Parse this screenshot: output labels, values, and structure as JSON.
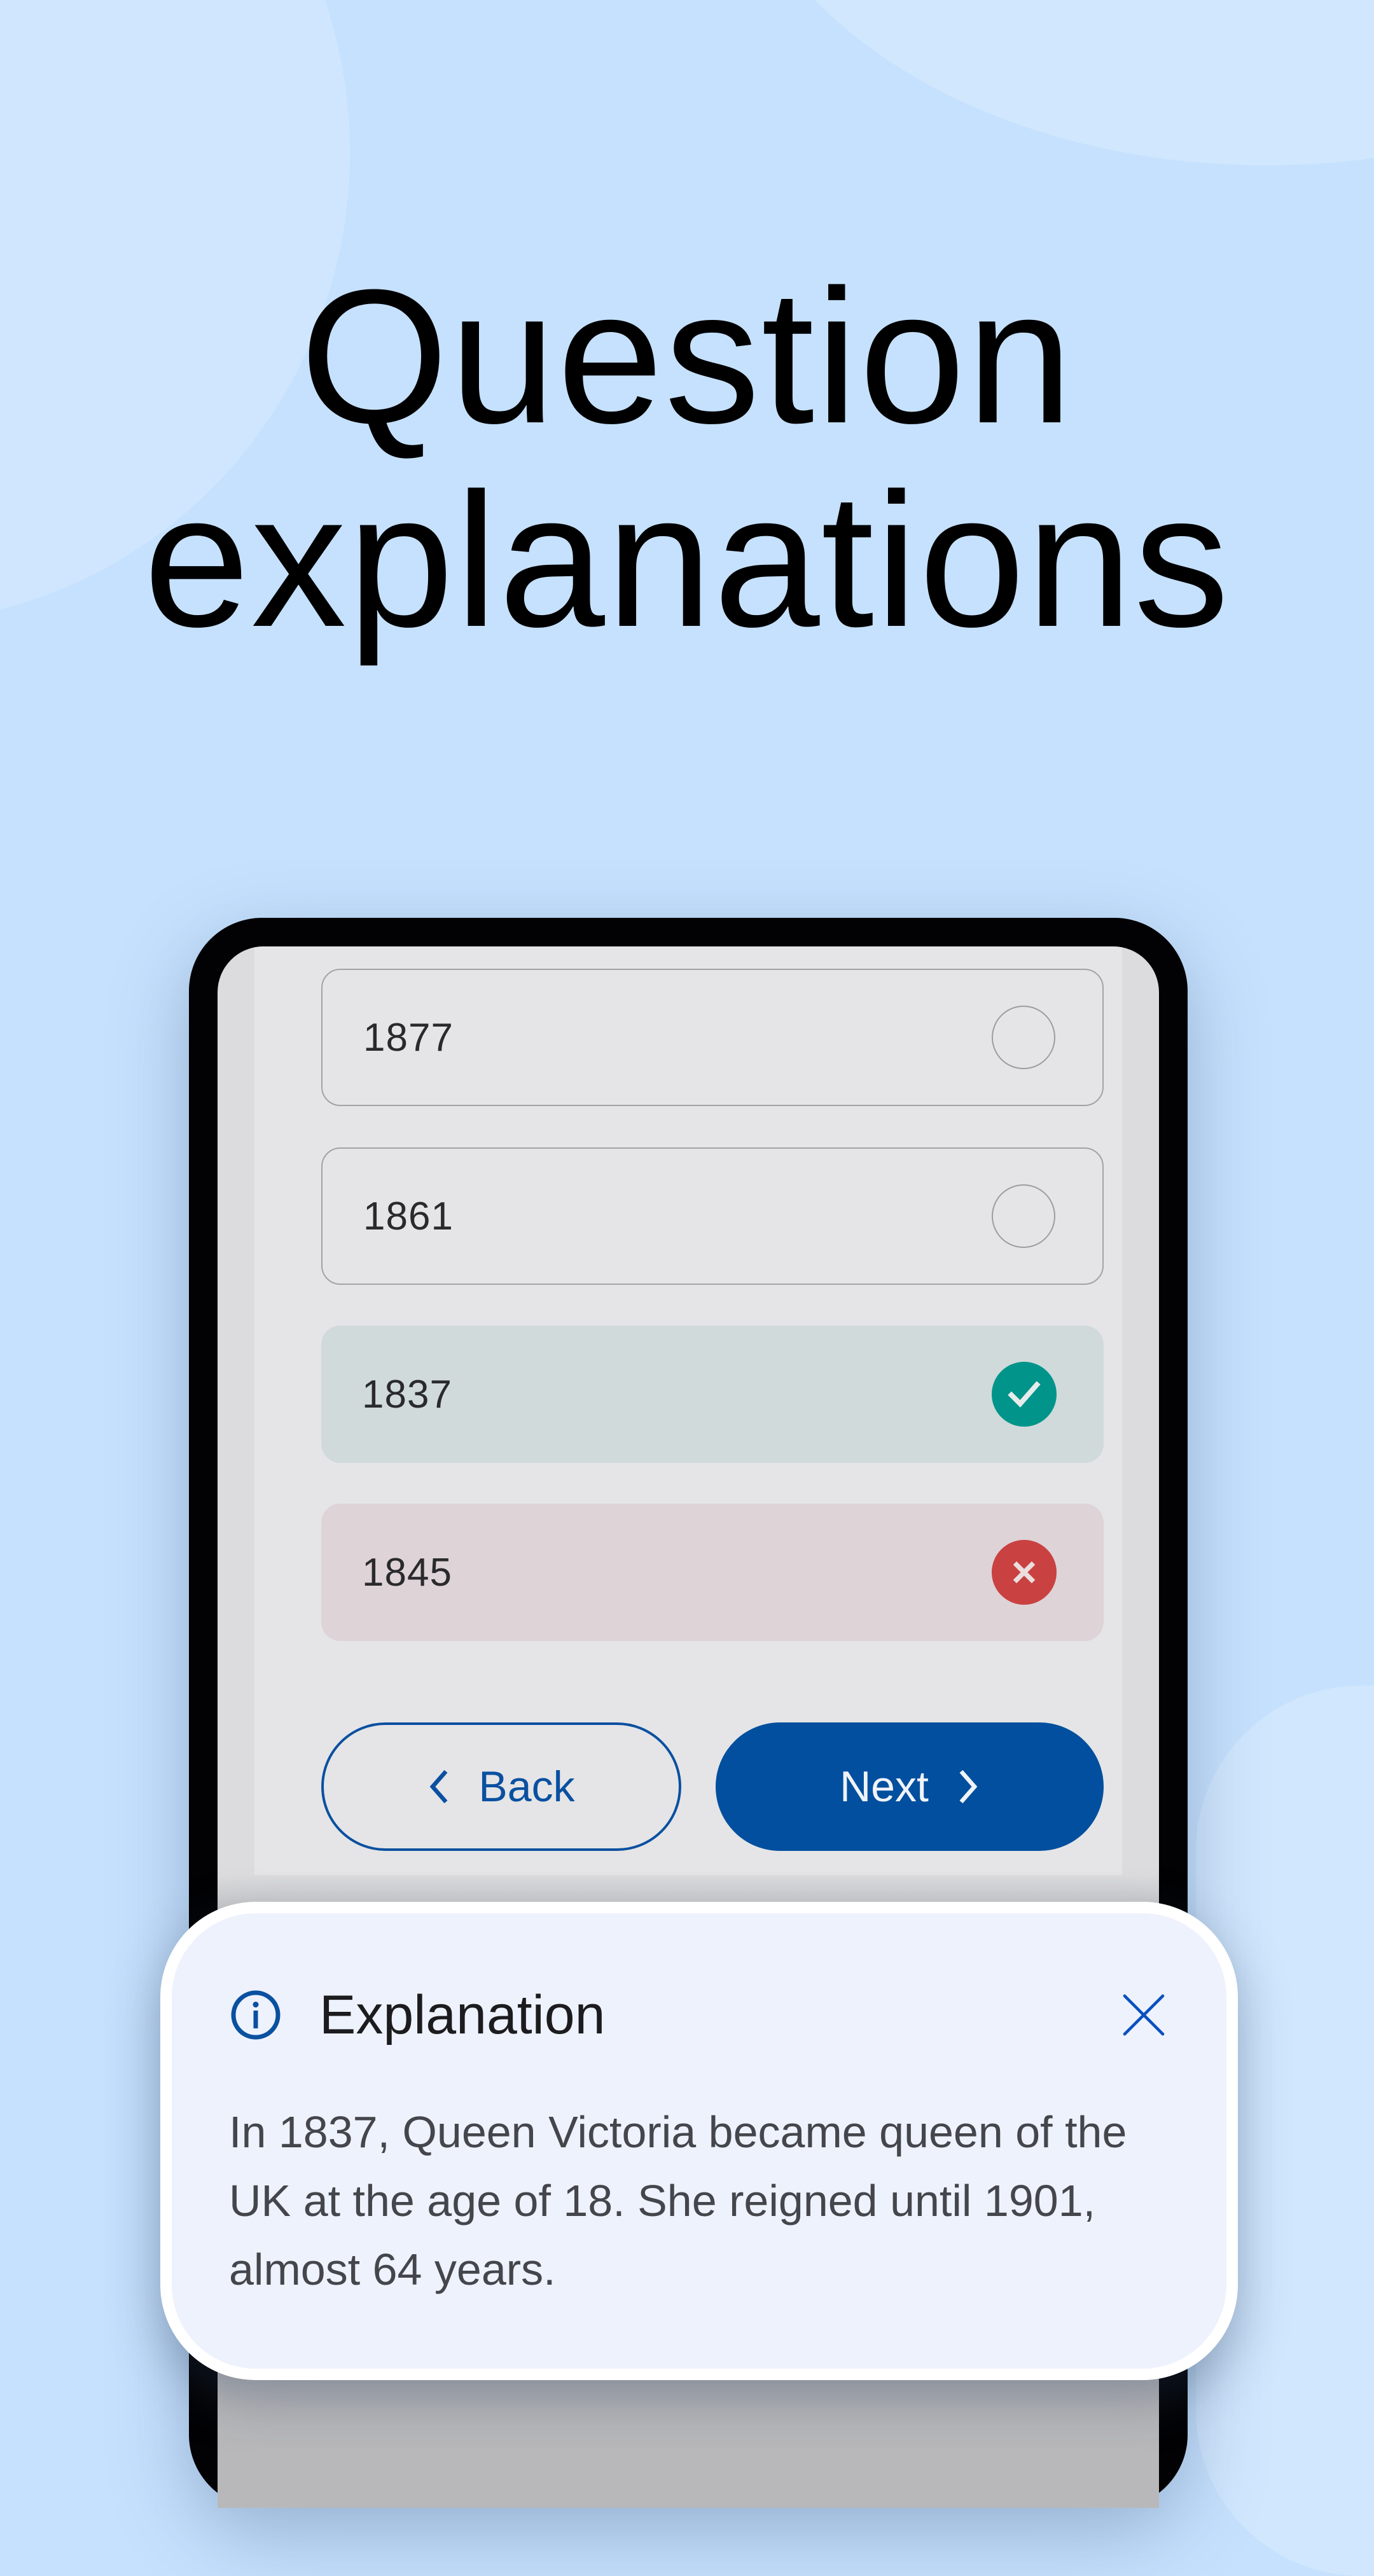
{
  "headline": {
    "line1": "Question",
    "line2": "explanations"
  },
  "quiz": {
    "answers": [
      {
        "label": "1877",
        "state": "unselected",
        "icon": "radio-empty-icon"
      },
      {
        "label": "1861",
        "state": "unselected",
        "icon": "radio-empty-icon"
      },
      {
        "label": "1837",
        "state": "correct",
        "icon": "check-circle-icon"
      },
      {
        "label": "1845",
        "state": "incorrect",
        "icon": "x-circle-icon"
      }
    ],
    "back_label": "Back",
    "next_label": "Next"
  },
  "explanation": {
    "icon": "info-icon",
    "title": "Explanation",
    "close_icon": "close-icon",
    "text": "In 1837, Queen Victoria became queen of the UK at the age of 18. She reigned until 1901, almost 64 years."
  },
  "colors": {
    "background": "#c6e1fd",
    "primary": "#014f9e",
    "correct": "#00948a",
    "incorrect": "#c94141",
    "correct_bg": "#d0dada",
    "incorrect_bg": "#ded3d7",
    "sheet_bg": "#eef2fc"
  }
}
